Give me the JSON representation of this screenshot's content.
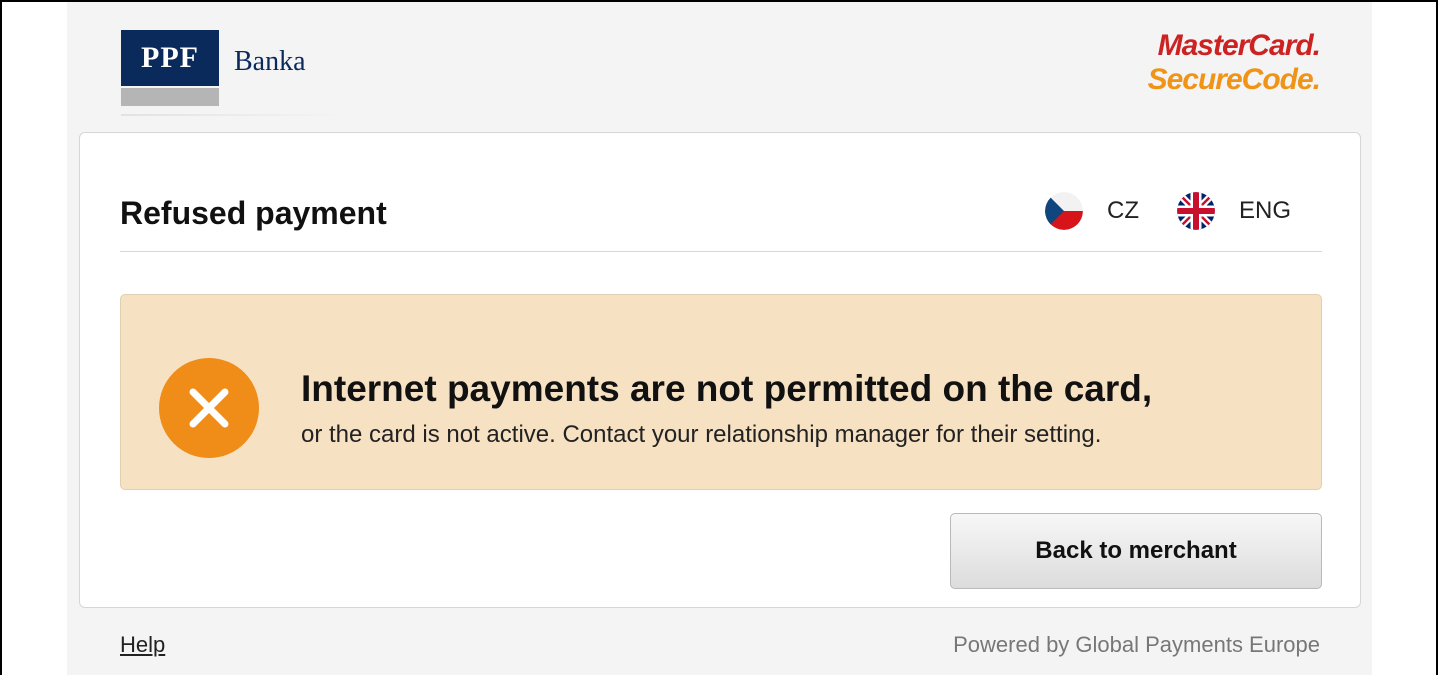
{
  "header": {
    "bank_logo_text": "PPF",
    "bank_name": "Banka",
    "card_scheme_logo_line1": "MasterCard.",
    "card_scheme_logo_line2": "SecureCode."
  },
  "card": {
    "title": "Refused payment",
    "languages": [
      {
        "code": "CZ",
        "icon": "czech-flag-icon"
      },
      {
        "code": "ENG",
        "icon": "uk-flag-icon"
      }
    ],
    "alert": {
      "icon": "close-icon",
      "heading": "Internet payments are not permitted on the card,",
      "text": "or the card is not active. Contact your relationship manager for their setting."
    },
    "back_button_label": "Back to merchant"
  },
  "footer": {
    "help_label": "Help",
    "powered_by": "Powered by Global Payments Europe"
  },
  "colors": {
    "brand_navy": "#0b2a5c",
    "alert_background": "#f6e1c3",
    "alert_icon": "#f08c18",
    "mastercard_red": "#cc2222",
    "securecode_orange": "#f09418"
  }
}
